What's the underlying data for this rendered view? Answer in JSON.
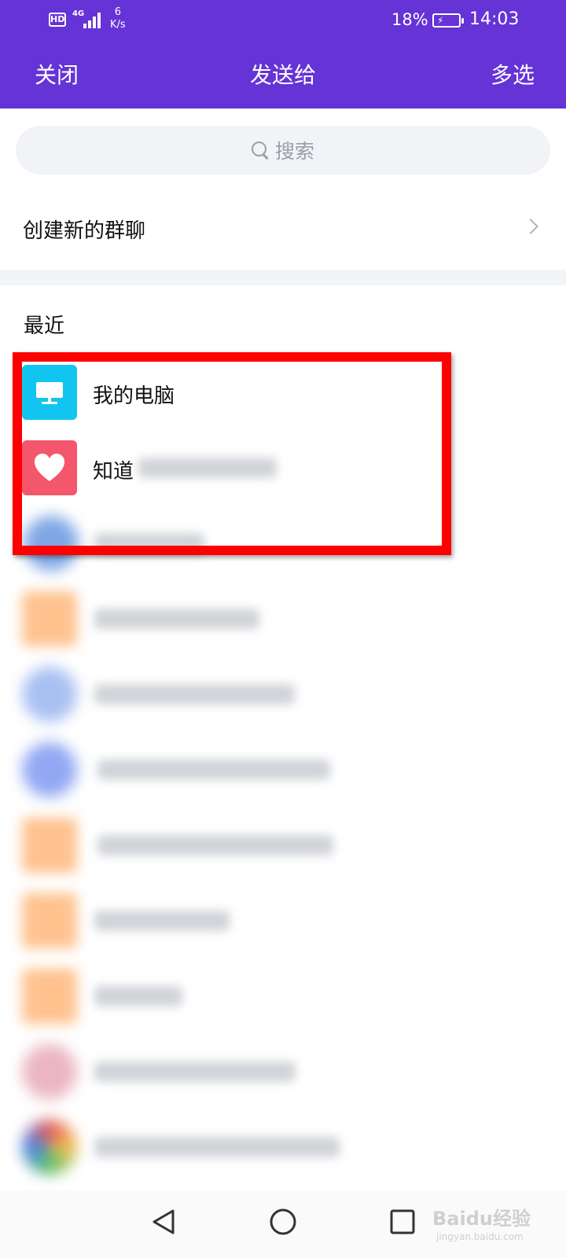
{
  "status_bar": {
    "hd": "HD",
    "network": "4G",
    "speed_value": "6",
    "speed_unit": "K/s",
    "battery": "18%",
    "time": "14:03"
  },
  "header": {
    "close_label": "关闭",
    "title": "发送给",
    "multi_select_label": "多选"
  },
  "search": {
    "placeholder": "搜索"
  },
  "create_group": {
    "label": "创建新的群聊"
  },
  "recent": {
    "section_title": "最近",
    "items": [
      {
        "name": "我的电脑",
        "icon": "computer-icon",
        "color": "#12c5f0"
      },
      {
        "name": "知道",
        "icon": "heart-icon",
        "color": "#f4566b"
      }
    ]
  },
  "colors": {
    "header_bg": "#6533d6",
    "highlight": "#ff0000"
  },
  "watermark": {
    "brand": "Baidu经验",
    "url": "jingyan.baidu.com"
  }
}
